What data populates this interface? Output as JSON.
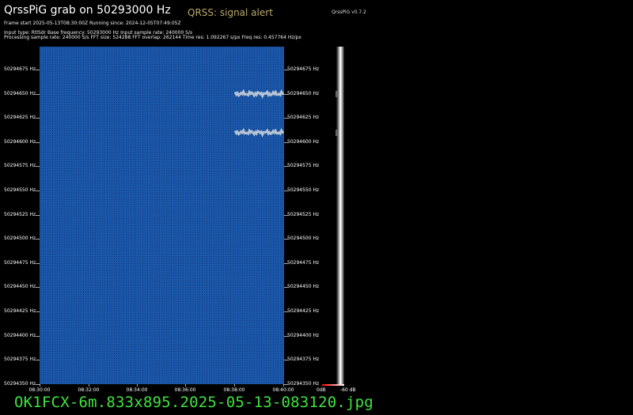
{
  "header": {
    "title": "QrssPiG grab on 50293000 Hz",
    "alert": "QRSS: signal alert",
    "version": "QrssPiG v0.7.2",
    "frame_start": "Frame start 2025-05-13T08:30:00Z Running since: 2024-12-05T07:49:05Z",
    "input_line": "Input type: RtlSdr Base frequency: 50293000 Hz Input sample rate: 240000 S/s",
    "processing_line": "Processing sample rate: 240000 S/s FFT size: 524288 FFT overlap: 262144 Time res: 1.092267 s/px Freq res: 0.457764 Hz/px"
  },
  "y_axis": {
    "labels": [
      "50294675 Hz",
      "50294650 Hz",
      "50294625 Hz",
      "50294600 Hz",
      "50294575 Hz",
      "50294550 Hz",
      "50294525 Hz",
      "50294500 Hz",
      "50294475 Hz",
      "50294450 Hz",
      "50294425 Hz",
      "50294400 Hz",
      "50294375 Hz",
      "50294350 Hz"
    ]
  },
  "x_axis": {
    "labels": [
      "08:30:00",
      "08:32:00",
      "08:34:00",
      "08:36:00",
      "08:38:00",
      "08:40:00"
    ]
  },
  "signals": [
    {
      "freq_hz": 50294650,
      "start": "08:38:00",
      "end": "08:40:00"
    },
    {
      "freq_hz": 50294610,
      "start": "08:38:00",
      "end": "08:40:00"
    }
  ],
  "scale": {
    "left": "0dB",
    "right": "-60 dB"
  },
  "footer": {
    "filename": "OK1FCX-6m.833x895.2025-05-13-083120.jpg"
  },
  "colors": {
    "waterfall": "#1a56a8",
    "filename": "#3fe23f",
    "alert": "#b8a86a"
  }
}
